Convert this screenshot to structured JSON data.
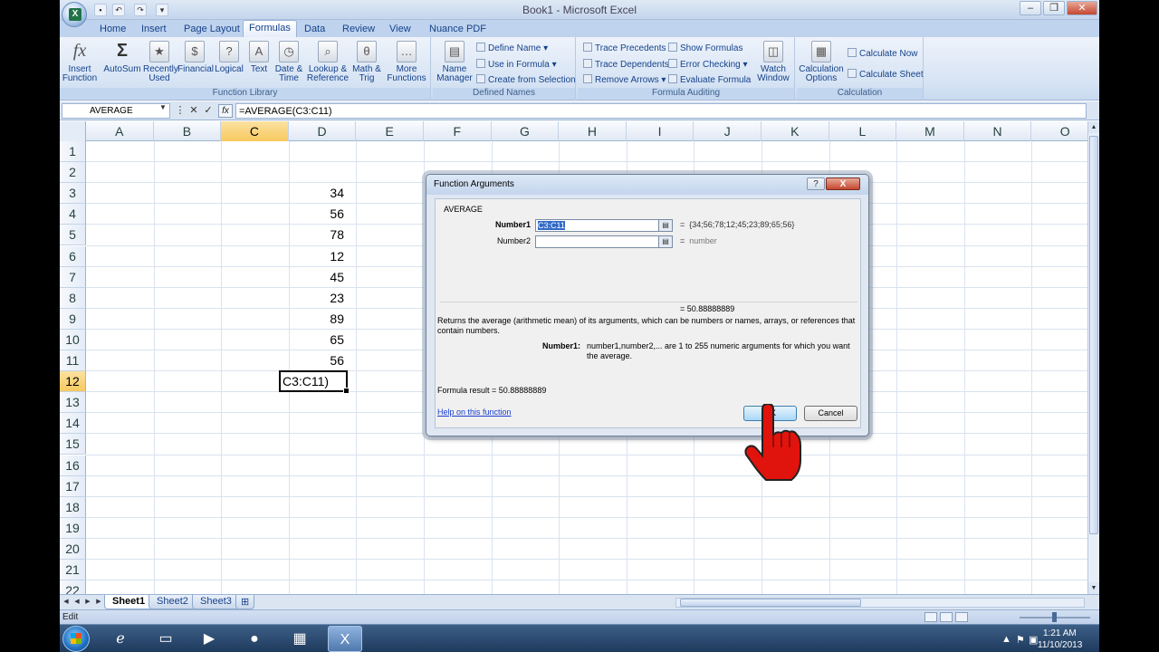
{
  "window": {
    "title": "Book1 - Microsoft Excel"
  },
  "tabs": [
    "Home",
    "Insert",
    "Page Layout",
    "Formulas",
    "Data",
    "Review",
    "View",
    "Nuance PDF"
  ],
  "active_tab": "Formulas",
  "ribbon": {
    "function_library": {
      "label": "Function Library",
      "insert_function": "Insert Function",
      "autosum": "AutoSum",
      "recently_used": "Recently Used",
      "financial": "Financial",
      "logical": "Logical",
      "text": "Text",
      "date_time": "Date & Time",
      "lookup_reference": "Lookup & Reference",
      "math_trig": "Math & Trig",
      "more_functions": "More Functions"
    },
    "defined_names": {
      "label": "Defined Names",
      "name_manager": "Name Manager",
      "define_name": "Define Name",
      "use_in_formula": "Use in Formula",
      "create_from_selection": "Create from Selection"
    },
    "formula_auditing": {
      "label": "Formula Auditing",
      "trace_precedents": "Trace Precedents",
      "trace_dependents": "Trace Dependents",
      "remove_arrows": "Remove Arrows",
      "show_formulas": "Show Formulas",
      "error_checking": "Error Checking",
      "evaluate_formula": "Evaluate Formula",
      "watch_window": "Watch Window"
    },
    "calculation": {
      "label": "Calculation",
      "calculation_options": "Calculation Options",
      "calculate_now": "Calculate Now",
      "calculate_sheet": "Calculate Sheet"
    }
  },
  "formula_bar": {
    "name_box": "AVERAGE",
    "formula": "=AVERAGE(C3:C11)",
    "fx": "fx"
  },
  "columns": [
    "A",
    "B",
    "C",
    "D",
    "E",
    "F",
    "G",
    "H",
    "I",
    "J",
    "K",
    "L",
    "M",
    "N",
    "O"
  ],
  "selected_column": "C",
  "rows": [
    "1",
    "2",
    "3",
    "4",
    "5",
    "6",
    "7",
    "8",
    "9",
    "10",
    "11",
    "12",
    "13",
    "14",
    "15",
    "16",
    "17",
    "18",
    "19",
    "20",
    "21",
    "22"
  ],
  "selected_row": "12",
  "cells": {
    "C3": "34",
    "C4": "56",
    "C5": "78",
    "C6": "12",
    "C7": "45",
    "C8": "23",
    "C9": "89",
    "C10": "65",
    "C11": "56"
  },
  "active_cell": {
    "text": "C3:C11)"
  },
  "sheets": [
    "Sheet1",
    "Sheet2",
    "Sheet3"
  ],
  "active_sheet": "Sheet1",
  "status": {
    "mode": "Edit"
  },
  "taskbar": {
    "time": "1:21 AM",
    "date": "11/10/2013"
  },
  "dialog": {
    "title": "Function Arguments",
    "function_name": "AVERAGE",
    "arg1_label": "Number1",
    "arg1_value": "C3:C11",
    "arg1_result": "{34;56;78;12;45;23;89;65;56}",
    "arg2_label": "Number2",
    "arg2_value": "",
    "arg2_result": "number",
    "eq": "=",
    "function_result": "= 50.88888889",
    "description": "Returns the average (arithmetic mean) of its arguments, which can be numbers or names, arrays, or references that contain numbers.",
    "arg_desc_label": "Number1:",
    "arg_desc": "number1,number2,... are 1 to 255 numeric arguments for which you want the average.",
    "formula_result": "Formula result =   50.88888889",
    "help_link": "Help on this function",
    "ok": "OK",
    "cancel": "Cancel",
    "help": "?",
    "close": "X"
  },
  "colors": {
    "accent": "#15428b",
    "selected_header": "#f8c95f",
    "ribbon": "#d7e4f4",
    "close": "#c5472f",
    "cursor": "#e0140c"
  }
}
